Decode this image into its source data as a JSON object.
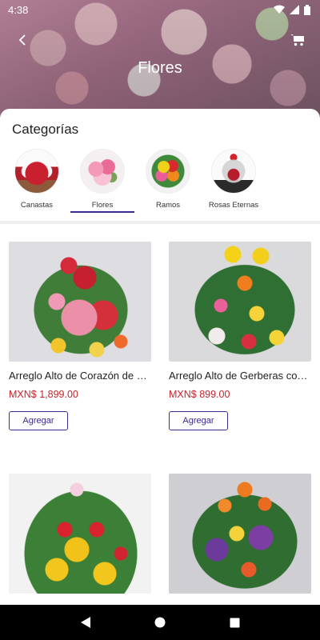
{
  "status_bar": {
    "time": "4:38"
  },
  "header": {
    "title": "Flores"
  },
  "categories": {
    "title": "Categorías",
    "items": [
      {
        "label": "Canastas",
        "selected": false
      },
      {
        "label": "Flores",
        "selected": true
      },
      {
        "label": "Ramos",
        "selected": false
      },
      {
        "label": "Rosas Eternas",
        "selected": false
      }
    ]
  },
  "products": [
    {
      "name": "Arreglo Alto de Corazón de Rosas",
      "price": "MXN$ 1,899.00",
      "button": "Agregar"
    },
    {
      "name": "Arreglo Alto de Gerberas con Rosas",
      "price": "MXN$ 899.00",
      "button": "Agregar"
    },
    {
      "name": "",
      "price": "",
      "button": ""
    },
    {
      "name": "",
      "price": "",
      "button": ""
    }
  ],
  "colors": {
    "accent": "#3b2a8f",
    "price": "#c3252b"
  },
  "icons": [
    "back-arrow-icon",
    "cart-icon",
    "wifi-icon",
    "signal-icon",
    "battery-icon",
    "nav-back-icon",
    "nav-home-icon",
    "nav-recents-icon"
  ]
}
